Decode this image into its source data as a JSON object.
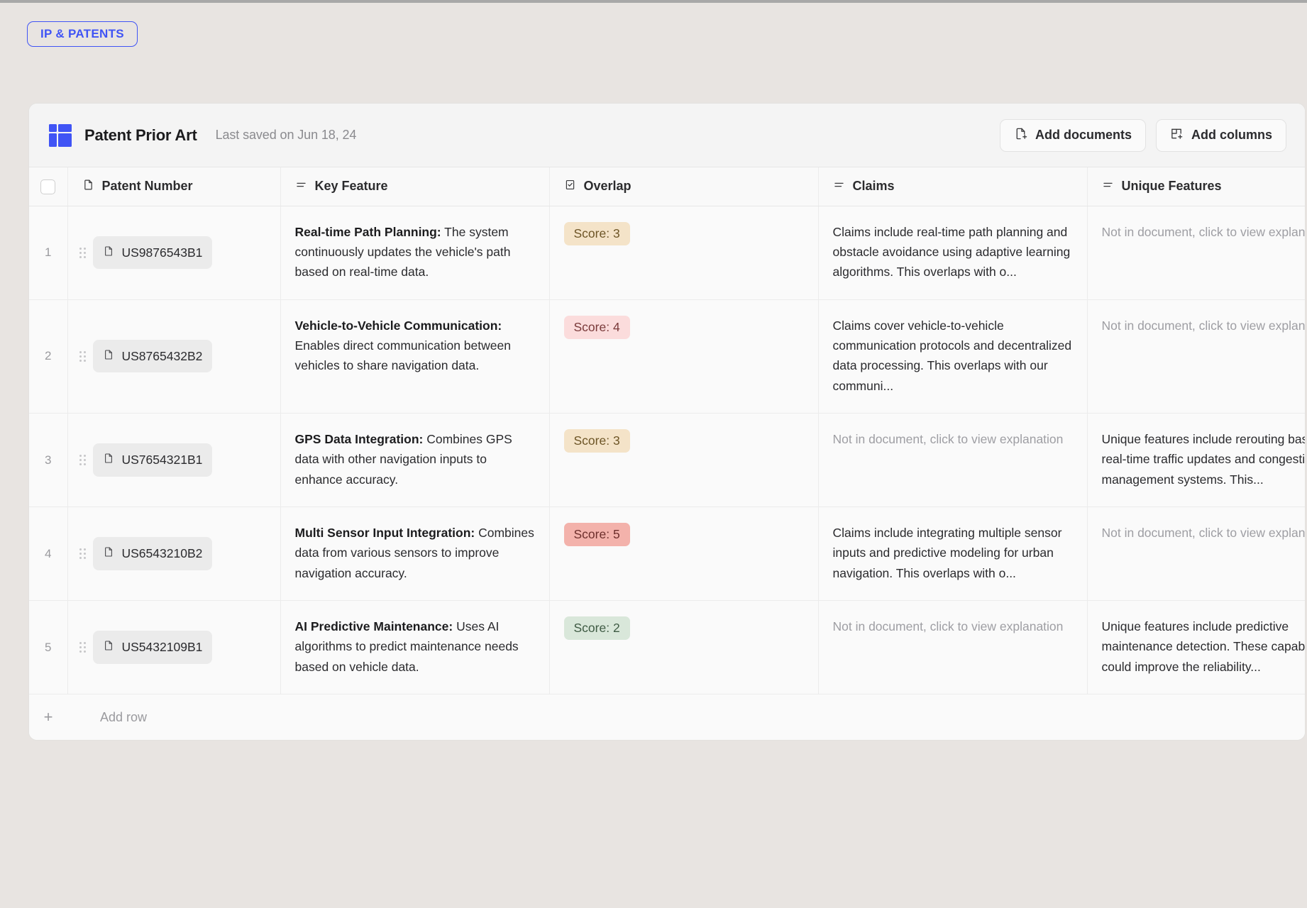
{
  "breadcrumb": {
    "label": "IP & PATENTS"
  },
  "header": {
    "logo_icon": "grid-table-icon",
    "title": "Patent Prior Art",
    "saved_status": "Last saved on Jun 18, 24",
    "actions": [
      {
        "label": "Add documents",
        "icon": "file-plus-icon"
      },
      {
        "label": "Add columns",
        "icon": "column-plus-icon"
      }
    ]
  },
  "table": {
    "columns": [
      {
        "label": "Patent Number",
        "icon": "file-icon"
      },
      {
        "label": "Key Feature",
        "icon": "text-lines-icon"
      },
      {
        "label": "Overlap",
        "icon": "checkbox-icon"
      },
      {
        "label": "Claims",
        "icon": "text-lines-icon"
      },
      {
        "label": "Unique Features",
        "icon": "text-lines-icon"
      }
    ],
    "rows": [
      {
        "index": "1",
        "patent_number": "US9876543B1",
        "key_feature_title": "Real-time Path Planning:",
        "key_feature_body": " The system continuously updates the vehicle's path based on real-time data.",
        "overlap_label": "Score: 3",
        "overlap_score": 3,
        "claims": "Claims include real-time path planning and obstacle avoidance using adaptive learning algorithms. This overlaps with o...",
        "claims_muted": false,
        "unique_features": "Not in document, click to view explanation",
        "unique_muted": true
      },
      {
        "index": "2",
        "patent_number": "US8765432B2",
        "key_feature_title": "Vehicle-to-Vehicle Communication:",
        "key_feature_body": " Enables direct communication between vehicles to share navigation data.",
        "overlap_label": "Score: 4",
        "overlap_score": 4,
        "claims": "Claims cover vehicle-to-vehicle communication protocols and decentralized data processing. This overlaps with our communi...",
        "claims_muted": false,
        "unique_features": "Not in document, click to view explanation",
        "unique_muted": true
      },
      {
        "index": "3",
        "patent_number": "US7654321B1",
        "key_feature_title": "GPS Data Integration:",
        "key_feature_body": " Combines GPS data with other navigation inputs to enhance accuracy.",
        "overlap_label": "Score: 3",
        "overlap_score": 3,
        "claims": "Not in document, click to view explanation",
        "claims_muted": true,
        "unique_features": "Unique features include rerouting based on real-time traffic updates and congestion management systems. This...",
        "unique_muted": false
      },
      {
        "index": "4",
        "patent_number": "US6543210B2",
        "key_feature_title": "Multi Sensor Input Integration:",
        "key_feature_body": " Combines data from various sensors to improve navigation accuracy.",
        "overlap_label": "Score: 5",
        "overlap_score": 5,
        "claims": "Claims include integrating multiple sensor inputs and predictive modeling for urban navigation. This overlaps with o...",
        "claims_muted": false,
        "unique_features": "Not in document, click to view explanation",
        "unique_muted": true
      },
      {
        "index": "5",
        "patent_number": "US5432109B1",
        "key_feature_title": "AI Predictive Maintenance:",
        "key_feature_body": " Uses AI algorithms to predict maintenance needs based on vehicle data.",
        "overlap_label": "Score: 2",
        "overlap_score": 2,
        "claims": "Not in document, click to view explanation",
        "claims_muted": true,
        "unique_features": "Unique features include predictive maintenance detection. These capabilities could improve the reliability...",
        "unique_muted": false
      }
    ],
    "add_row_label": "Add row",
    "add_row_icon": "plus-icon"
  },
  "colors": {
    "accent": "#4054f5",
    "page_bg": "#e8e4e1",
    "card_bg": "#fafafa",
    "score_2": "#d9e7da",
    "score_3": "#f4e3c8",
    "score_4": "#fbdcdc",
    "score_5": "#f3b2ab"
  }
}
